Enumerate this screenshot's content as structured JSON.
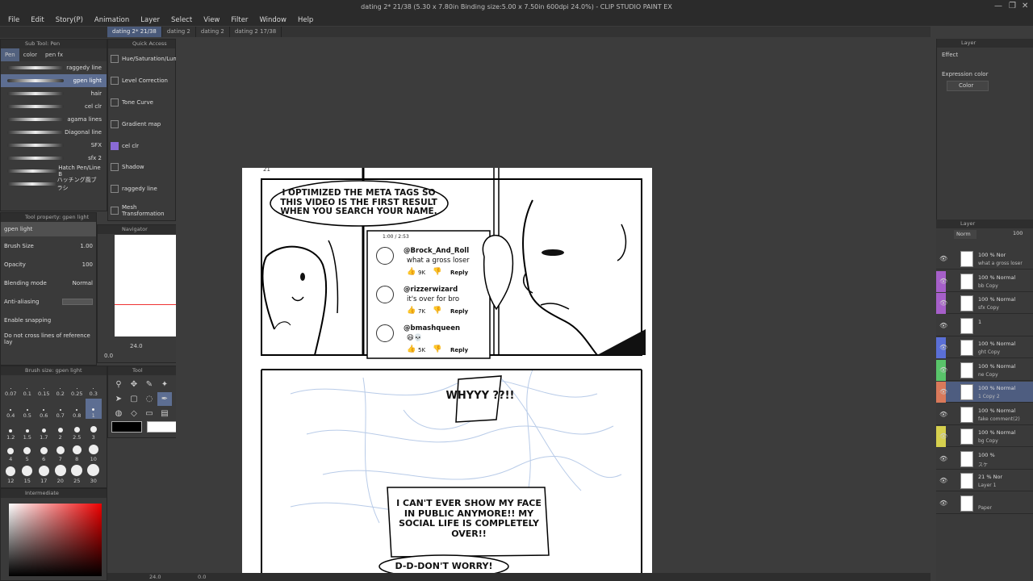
{
  "window": {
    "title": "dating 2* 21/38 (5.30 x 7.80in Binding size:5.00 x 7.50in 600dpi 24.0%) - CLIP STUDIO PAINT EX"
  },
  "menu": [
    "File",
    "Edit",
    "Story(P)",
    "Animation",
    "Layer",
    "Select",
    "View",
    "Filter",
    "Window",
    "Help"
  ],
  "tabs": [
    "dating 2* 21/38",
    "dating 2",
    "dating 2",
    "dating 2  17/38"
  ],
  "subtool": {
    "title": "Sub Tool: Pen",
    "tabs": [
      "Pen",
      "color",
      "pen fx"
    ],
    "brushes": [
      "raggedy line",
      "gpen light",
      "hair",
      "cel clr",
      "agama lines",
      "Diagonal line",
      "SFX",
      "sfx 2",
      "Hatch Pen/Line B",
      "ハッチング風ブラシ"
    ]
  },
  "quick_access": {
    "title": "Quick Access",
    "items": [
      "Hue/Saturation/Luminosity",
      "Level Correction",
      "Tone Curve",
      "Gradient map",
      "cel clr",
      "Shadow",
      "raggedy line",
      "Mesh Transformation"
    ]
  },
  "tool_property": {
    "title": "Tool property: gpen light",
    "name": "gpen light",
    "brush_size_label": "Brush Size",
    "brush_size": "1.00",
    "opacity_label": "Opacity",
    "opacity": "100",
    "blending_label": "Blending mode",
    "blending": "Normal",
    "antialias_label": "Anti-aliasing",
    "snapping": "Enable snapping",
    "ref_layer": "Do not cross lines of reference lay"
  },
  "navigator": {
    "title": "Navigator",
    "zoom": "24.0",
    "angle": "0.0"
  },
  "brush_size": {
    "title": "Brush size: gpen light",
    "sizes": [
      "0.07",
      "0.1",
      "0.15",
      "0.2",
      "0.25",
      "0.3",
      "0.4",
      "0.5",
      "0.6",
      "0.7",
      "0.8",
      "1",
      "1.2",
      "1.5",
      "1.7",
      "2",
      "2.5",
      "3",
      "4",
      "5",
      "6",
      "7",
      "8",
      "10",
      "12",
      "15",
      "17",
      "20",
      "25",
      "30"
    ],
    "selected": "1",
    "dot_sizes": [
      1,
      1,
      1,
      1,
      1,
      1,
      2,
      2,
      2,
      2,
      2,
      3,
      4,
      4,
      5,
      6,
      7,
      8,
      8,
      9,
      9,
      10,
      11,
      12,
      12,
      13,
      13,
      14,
      14,
      15
    ]
  },
  "tool": {
    "title": "Tool",
    "icons": [
      "zoom-icon",
      "move-icon",
      "eyedropper-icon",
      "magic-icon",
      "sparkle-icon",
      "move-arrows-icon",
      "rotate-icon",
      "operation-icon",
      "select-icon",
      "lasso-icon",
      "pen-icon",
      "pencil-icon",
      "text-icon",
      "fill-icon",
      "blend-icon",
      "shape-icon",
      "frame-icon",
      "ruler-icon",
      "brush-icon",
      "eraser-icon",
      "gradient-icon"
    ]
  },
  "color_panel": {
    "title": "Intermediate"
  },
  "comic": {
    "bubble1": "I OPTIMIZED THE META TAGS SO THIS VIDEO IS THE FIRST RESULT WHEN YOU SEARCH YOUR NAME.",
    "player_time": "1:00 / 2:53",
    "comments": [
      {
        "user": "@Brock_And_Roll",
        "text": "what a gross loser",
        "likes": "9K",
        "reply": "Reply"
      },
      {
        "user": "@rizzerwizard",
        "text": "it's over for bro",
        "likes": "7K",
        "reply": "Reply"
      },
      {
        "user": "@bmashqueen",
        "text": "😆💀",
        "likes": "5K",
        "reply": "Reply"
      }
    ],
    "bubble2": "WHYYY ??!!",
    "bubble3": "I CAN'T EVER SHOW MY FACE IN PUBLIC ANYMORE!! MY SOCIAL LIFE IS COMPLETELY OVER!!",
    "bubble4": "D-D-DON'T WORRY!",
    "page_num": "21"
  },
  "right_panel": {
    "title": "Layer",
    "effect_label": "Effect",
    "expression_label": "Expression color",
    "expression_value": "Color"
  },
  "layers_panel": {
    "title": "Layer",
    "blend": "Norm",
    "opacity": "100"
  },
  "layers": [
    {
      "l1": "100 % Nor",
      "l2": "what a gross loser",
      "color": ""
    },
    {
      "l1": "100 % Normal",
      "l2": "bb Copy",
      "color": "#a65fc9"
    },
    {
      "l1": "100 % Normal",
      "l2": "sfx Copy",
      "color": "#a65fc9"
    },
    {
      "l1": "1",
      "l2": "",
      "color": ""
    },
    {
      "l1": "100 % Normal",
      "l2": "ght Copy",
      "color": "#5a6fd6"
    },
    {
      "l1": "100 % Normal",
      "l2": "ne Copy",
      "color": "#59c46a"
    },
    {
      "l1": "100 % Normal",
      "l2": "1 Copy 2",
      "color": "#d9795a"
    },
    {
      "l1": "100 % Normal",
      "l2": "fake comment(2)",
      "color": ""
    },
    {
      "l1": "100 % Normal",
      "l2": "bg Copy",
      "color": "#d6d04e"
    },
    {
      "l1": "100 %",
      "l2": "スケ",
      "color": ""
    },
    {
      "l1": "21 % Nor",
      "l2": "Layer 1",
      "color": ""
    },
    {
      "l1": "",
      "l2": "Paper",
      "color": ""
    }
  ],
  "status": {
    "zoom": "24.0",
    "angle": "0.0"
  }
}
